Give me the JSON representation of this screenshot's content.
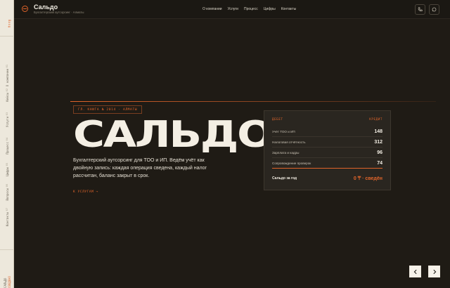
{
  "brand": {
    "name": "Сальдо",
    "subtitle": "Бухгалтерский аутсорсинг · Алматы"
  },
  "nav": [
    "О компании",
    "Услуги",
    "Процесс",
    "Цифры",
    "Контакты"
  ],
  "header_buttons": {
    "phone_icon": "phone-icon",
    "whatsapp_icon": "whatsapp-icon"
  },
  "rail": {
    "top_label": "Вход",
    "items": [
      {
        "num": "01",
        "label": "О компании"
      },
      {
        "num": "02",
        "label": "Кейсы"
      },
      {
        "num": "03",
        "label": "Услуги"
      },
      {
        "num": "04",
        "label": "Процесс"
      },
      {
        "num": "05",
        "label": "Цифры"
      },
      {
        "num": "06",
        "label": "Вопросы"
      },
      {
        "num": "07",
        "label": "Контакты"
      }
    ],
    "bottom": {
      "a": "САЛЬДО",
      "b": "СВЕДЕНО"
    }
  },
  "hero": {
    "tag": "ГЛ. КНИГА № 2014 · АЛМАТЫ",
    "title": "САЛЬДО",
    "description": "Бухгалтерский аутсорсинг для ТОО и ИП. Ведём учёт как двойную запись: каждая операция сведена, каждый налог рассчитан, баланс закрыт в срок.",
    "link": "К УСЛУГАМ →"
  },
  "ledger": {
    "debit_label": "ДЕБЕТ",
    "credit_label": "КРЕДИТ",
    "rows": [
      {
        "label": "Учёт ТОО и ИП",
        "value": "148"
      },
      {
        "label": "Налоговая отчётность",
        "value": "312"
      },
      {
        "label": "Зарплата и кадры",
        "value": "96"
      },
      {
        "label": "Сопровождение проверок",
        "value": "74"
      }
    ],
    "total_label": "Сальдо за год",
    "total_value": "0 ₸ · сведён"
  },
  "colors": {
    "accent": "#e0642a",
    "background": "#1f1b15",
    "rail": "#ede8dc"
  }
}
